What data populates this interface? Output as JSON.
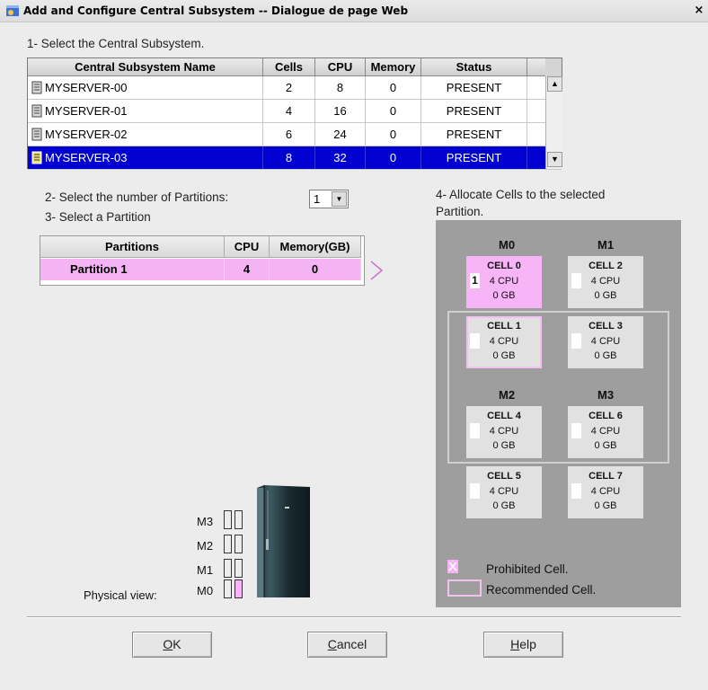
{
  "window": {
    "title": "Add and Configure Central Subsystem -- Dialogue de page Web",
    "close_glyph": "×"
  },
  "step1": {
    "label": "1- Select the Central Subsystem."
  },
  "subsystems": {
    "headers": [
      "Central Subsystem Name",
      "Cells",
      "CPU",
      "Memory",
      "Status"
    ],
    "rows": [
      {
        "name": "MYSERVER-00",
        "cells": "2",
        "cpu": "8",
        "memory": "0",
        "status": "PRESENT"
      },
      {
        "name": "MYSERVER-01",
        "cells": "4",
        "cpu": "16",
        "memory": "0",
        "status": "PRESENT"
      },
      {
        "name": "MYSERVER-02",
        "cells": "6",
        "cpu": "24",
        "memory": "0",
        "status": "PRESENT"
      },
      {
        "name": "MYSERVER-03",
        "cells": "8",
        "cpu": "32",
        "memory": "0",
        "status": "PRESENT"
      }
    ],
    "selected_index": 3
  },
  "step2": {
    "label": "2- Select the number of Partitions:",
    "value": "1"
  },
  "step3": {
    "label": "3- Select a Partition"
  },
  "partitions": {
    "headers": [
      "Partitions",
      "CPU",
      "Memory(GB)"
    ],
    "rows": [
      {
        "name": "Partition 1",
        "cpu": "4",
        "memory": "0"
      }
    ]
  },
  "step4": {
    "label_line1": "4- Allocate Cells to the selected",
    "label_line2": "Partition."
  },
  "modules": {
    "m0": "M0",
    "m1": "M1",
    "m2": "M2",
    "m3": "M3"
  },
  "cells": {
    "cell0": {
      "name": "CELL 0",
      "cpu": "4 CPU",
      "mem": "0 GB",
      "slot": "1"
    },
    "cell1": {
      "name": "CELL 1",
      "cpu": "4 CPU",
      "mem": "0 GB",
      "slot": ""
    },
    "cell2": {
      "name": "CELL 2",
      "cpu": "4 CPU",
      "mem": "0 GB",
      "slot": ""
    },
    "cell3": {
      "name": "CELL 3",
      "cpu": "4 CPU",
      "mem": "0 GB",
      "slot": ""
    },
    "cell4": {
      "name": "CELL 4",
      "cpu": "4 CPU",
      "mem": "0 GB",
      "slot": ""
    },
    "cell5": {
      "name": "CELL 5",
      "cpu": "4 CPU",
      "mem": "0 GB",
      "slot": ""
    },
    "cell6": {
      "name": "CELL 6",
      "cpu": "4 CPU",
      "mem": "0 GB",
      "slot": ""
    },
    "cell7": {
      "name": "CELL 7",
      "cpu": "4 CPU",
      "mem": "0 GB",
      "slot": ""
    }
  },
  "legend": {
    "prohibited": "Prohibited Cell.",
    "recommended": "Recommended Cell."
  },
  "physical_view": {
    "label": "Physical view:",
    "m3": "M3",
    "m2": "M2",
    "m1": "M1",
    "m0": "M0"
  },
  "buttons": {
    "ok_key": "O",
    "ok_rest": "K",
    "cancel_key": "C",
    "cancel_rest": "ancel",
    "help_key": "H",
    "help_rest": "elp"
  },
  "colors": {
    "selection": "#0000d0",
    "partition_pink": "#f7b4f7",
    "panel_gray": "#9e9e9e"
  }
}
